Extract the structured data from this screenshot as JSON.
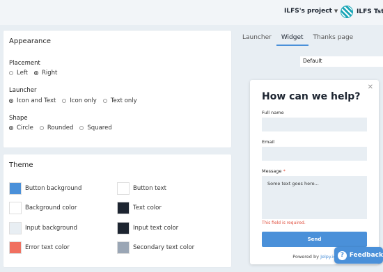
{
  "header": {
    "project_name": "ILFS's project",
    "user_name": "ILFS Tst",
    "icons": [
      "chevron-down-icon",
      "avatar-icon"
    ]
  },
  "appearance": {
    "title": "Appearance",
    "placement": {
      "label": "Placement",
      "options": [
        "Left",
        "Right"
      ],
      "selected": "Right"
    },
    "launcher": {
      "label": "Launcher",
      "options": [
        "Icon and Text",
        "Icon only",
        "Text only"
      ],
      "selected": "Icon and Text"
    },
    "shape": {
      "label": "Shape",
      "options": [
        "Circle",
        "Rounded",
        "Squared"
      ],
      "selected": "Circle"
    }
  },
  "theme": {
    "title": "Theme",
    "items": [
      {
        "label": "Button background",
        "color": "#4a90d9"
      },
      {
        "label": "Button text",
        "color": "#ffffff"
      },
      {
        "label": "Background color",
        "color": "#ffffff"
      },
      {
        "label": "Text color",
        "color": "#1c2430"
      },
      {
        "label": "Input background",
        "color": "#e8eef3"
      },
      {
        "label": "Input text color",
        "color": "#1c2430"
      },
      {
        "label": "Error text color",
        "color": "#f07060"
      },
      {
        "label": "Secondary text color",
        "color": "#9aa6b5"
      }
    ]
  },
  "tabs": {
    "items": [
      "Launcher",
      "Widget",
      "Thanks page"
    ],
    "active": "Widget"
  },
  "template_select": {
    "value": "Default"
  },
  "widget_preview": {
    "title": "How can we help?",
    "close_icon": "close-icon",
    "fields": {
      "full_name_label": "Full name",
      "email_label": "Email",
      "message_label": "Message",
      "required_marker": "*",
      "message_value": "Some text goes here..."
    },
    "error": "This field is required.",
    "send_label": "Send",
    "powered_prefix": "Powered by",
    "powered_link": "Jelpy.io"
  },
  "feedback_button": {
    "label": "Feedback",
    "icon": "question-icon"
  },
  "colors": {
    "accent": "#4a90d9",
    "error": "#e04b3a",
    "background": "#e8eef3"
  }
}
